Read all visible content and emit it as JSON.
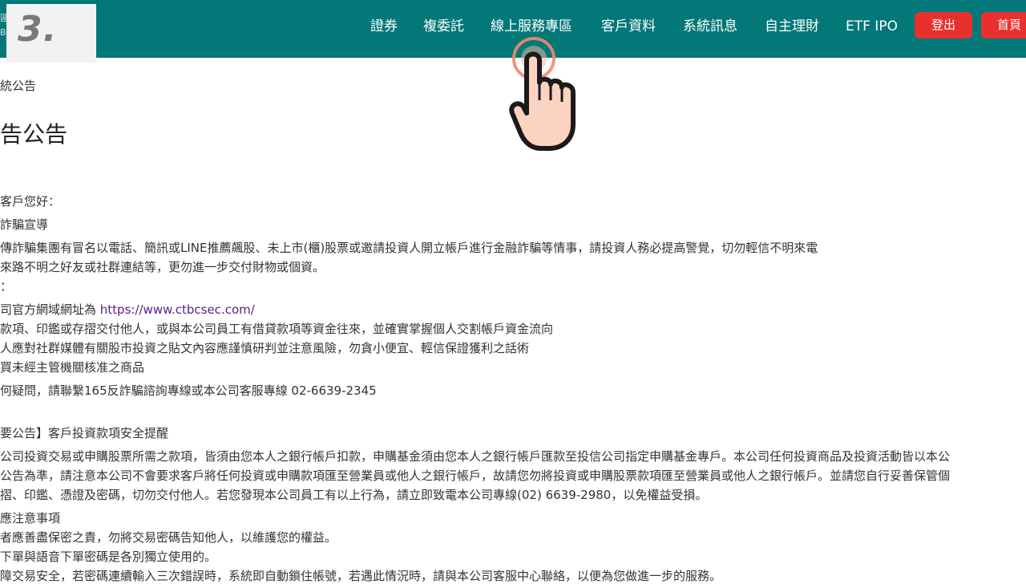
{
  "step": {
    "number": "3."
  },
  "logo": {
    "fragment": "區 BO"
  },
  "nav": {
    "items": [
      {
        "label": "證券"
      },
      {
        "label": "複委託"
      },
      {
        "label": "線上服務專區"
      },
      {
        "label": "客戶資料"
      },
      {
        "label": "系統訊息"
      },
      {
        "label": "自主理財"
      },
      {
        "label": "ETF IPO"
      }
    ],
    "logout": "登出",
    "home": "首頁"
  },
  "breadcrumb": "統公告",
  "page_title": "告公告",
  "notice": {
    "greeting": "客戶您好：",
    "fraud_heading": "詐騙宣導",
    "fraud_p1": "傳詐騙集團有冒名以電話、簡訊或LINE推薦飆股、未上市(櫃)股票或邀請投資人開立帳戶進行金融詐騙等情事，請投資人務必提高警覺，切勿輕信不明來電",
    "fraud_p2": "來路不明之好友或社群連結等，更勿進一步交付財物或個資。",
    "colon_line": "：",
    "site_prefix": "司官方網域網址為 ",
    "site_url": "https://www.ctbcsec.com/",
    "item2": "款項、印鑑或存摺交付他人，或與本公司員工有借貸款項等資金往來，並確實掌握個人交割帳戶資金流向",
    "item3": "人應對社群媒體有關股市投資之貼文內容應謹慎研判並注意風險，勿貪小便宜、輕信保證獲利之話術",
    "item4": "買未經主管機關核准之商品",
    "contact": "何疑問，請聯繫165反詐騙諮詢專線或本公司客服專線 02-6639-2345",
    "important_heading": "要公告】客戶投資款項安全提醒",
    "important_p1": "公司投資交易或申購股票所需之款項，皆須由您本人之銀行帳戶扣款，申購基金須由您本人之銀行帳戶匯款至投信公司指定申購基金專戶。本公司任何投資商品及投資活動皆以本公",
    "important_p2": "公告為準，請注意本公司不會要求客戶將任何投資或申購款項匯至營業員或他人之銀行帳戶，故請您勿將投資或申購股票款項匯至營業員或他人之銀行帳戶。並請您自行妥善保管個",
    "important_p3": "摺、印鑑、憑證及密碼，切勿交付他人。若您發現本公司員工有以上行為，請立即致電本公司專線(02) 6639-2980，以免權益受損。",
    "attention_heading": "應注意事項",
    "attention_1": "者應善盡保密之責，勿將交易密碼告知他人，以維護您的權益。",
    "attention_2": "下單與語音下單密碼是各別獨立使用的。",
    "attention_3": "障交易安全，若密碼連續輸入三次錯誤時，系統即自動鎖住帳號，若遇此情況時，請與本公司客服中心聯絡，以便為您做進一步的服務。"
  },
  "colors": {
    "header_bg": "#027878",
    "button_red": "#e8312f",
    "link_purple": "#5a1d8c"
  },
  "icons": {
    "cursor": "pointing-hand-icon"
  }
}
